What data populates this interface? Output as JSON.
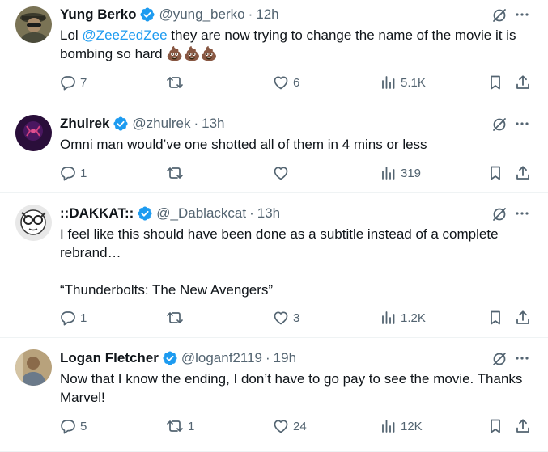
{
  "replies": [
    {
      "name": "Yung Berko",
      "handle": "@yung_berko",
      "time": "12h",
      "text_before": "Lol ",
      "mention": "@ZeeZedZee",
      "text_after": " they are now trying to change the name of the movie it is bombing so hard ",
      "emoji": "💩💩💩",
      "replies": "7",
      "reposts": "",
      "likes": "6",
      "views": "5.1K"
    },
    {
      "name": "Zhulrek",
      "handle": "@zhulrek",
      "time": "13h",
      "text": "Omni man would’ve one shotted all of them in 4 mins or less",
      "replies": "1",
      "reposts": "",
      "likes": "",
      "views": "319"
    },
    {
      "name": "::DAKKAT::",
      "handle": "@_Dablackcat",
      "time": "13h",
      "text": "I feel like this should have been done as a subtitle instead of a complete rebrand…\n\n“Thunderbolts: The New Avengers”",
      "replies": "1",
      "reposts": "",
      "likes": "3",
      "views": "1.2K"
    },
    {
      "name": "Logan Fletcher",
      "handle": "@loganf2119",
      "time": "19h",
      "text": "Now that I know the ending, I don’t have to go pay to see the movie. Thanks Marvel!",
      "replies": "5",
      "reposts": "1",
      "likes": "24",
      "views": "12K"
    }
  ],
  "separator": "·",
  "colors": {
    "text": "#0f1419",
    "secondary": "#536471",
    "link": "#1d9bf0",
    "verified": "#1d9bf0",
    "divider": "#eff3f4"
  },
  "icons": [
    "verified-badge-icon",
    "grok-icon",
    "more-icon",
    "reply-icon",
    "repost-icon",
    "like-icon",
    "views-icon",
    "bookmark-icon",
    "share-icon"
  ]
}
